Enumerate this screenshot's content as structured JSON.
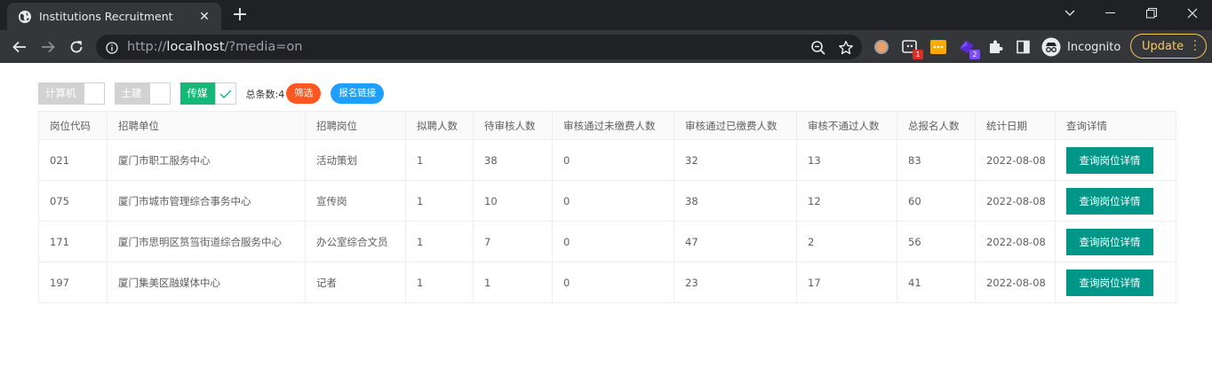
{
  "browser": {
    "tab_title": "Institutions Recruitment",
    "url_scheme": "http://",
    "url_host": "localhost",
    "url_path": "/?media=on",
    "incognito_label": "Incognito",
    "update_label": "Update",
    "ext_badges": [
      "1",
      "2"
    ],
    "colors": {
      "frame": "#202124",
      "toolbar": "#35363a",
      "update": "#f6c95a"
    }
  },
  "filters": {
    "items": [
      {
        "label": "计算机",
        "checked": false
      },
      {
        "label": "土建",
        "checked": false
      },
      {
        "label": "传媒",
        "checked": true
      }
    ],
    "total_text": "总条数:4",
    "filter_button": "筛选",
    "link_button": "报名链接",
    "colors": {
      "checked": "#16b777",
      "unchecked": "#d2d2d2",
      "filter": "#ff5722",
      "link": "#1e9fff"
    }
  },
  "table": {
    "columns": [
      "岗位代码",
      "招聘单位",
      "招聘岗位",
      "拟聘人数",
      "待审核人数",
      "审核通过未缴费人数",
      "审核通过已缴费人数",
      "审核不通过人数",
      "总报名人数",
      "统计日期",
      "查询详情"
    ],
    "rows": [
      {
        "code": "021",
        "unit": "厦门市职工服务中心",
        "post": "活动策划",
        "planned": "1",
        "pending": "38",
        "approved_unpaid": "0",
        "approved_paid": "32",
        "rejected": "13",
        "total": "83",
        "date": "2022-08-08",
        "action": "查询岗位详情"
      },
      {
        "code": "075",
        "unit": "厦门市城市管理综合事务中心",
        "post": "宣传岗",
        "planned": "1",
        "pending": "10",
        "approved_unpaid": "0",
        "approved_paid": "38",
        "rejected": "12",
        "total": "60",
        "date": "2022-08-08",
        "action": "查询岗位详情"
      },
      {
        "code": "171",
        "unit": "厦门市思明区筼筜街道综合服务中心",
        "post": "办公室综合文员",
        "planned": "1",
        "pending": "7",
        "approved_unpaid": "0",
        "approved_paid": "47",
        "rejected": "2",
        "total": "56",
        "date": "2022-08-08",
        "action": "查询岗位详情"
      },
      {
        "code": "197",
        "unit": "厦门集美区融媒体中心",
        "post": "记者",
        "planned": "1",
        "pending": "1",
        "approved_unpaid": "0",
        "approved_paid": "23",
        "rejected": "17",
        "total": "41",
        "date": "2022-08-08",
        "action": "查询岗位详情"
      }
    ],
    "action_color": "#009688"
  }
}
